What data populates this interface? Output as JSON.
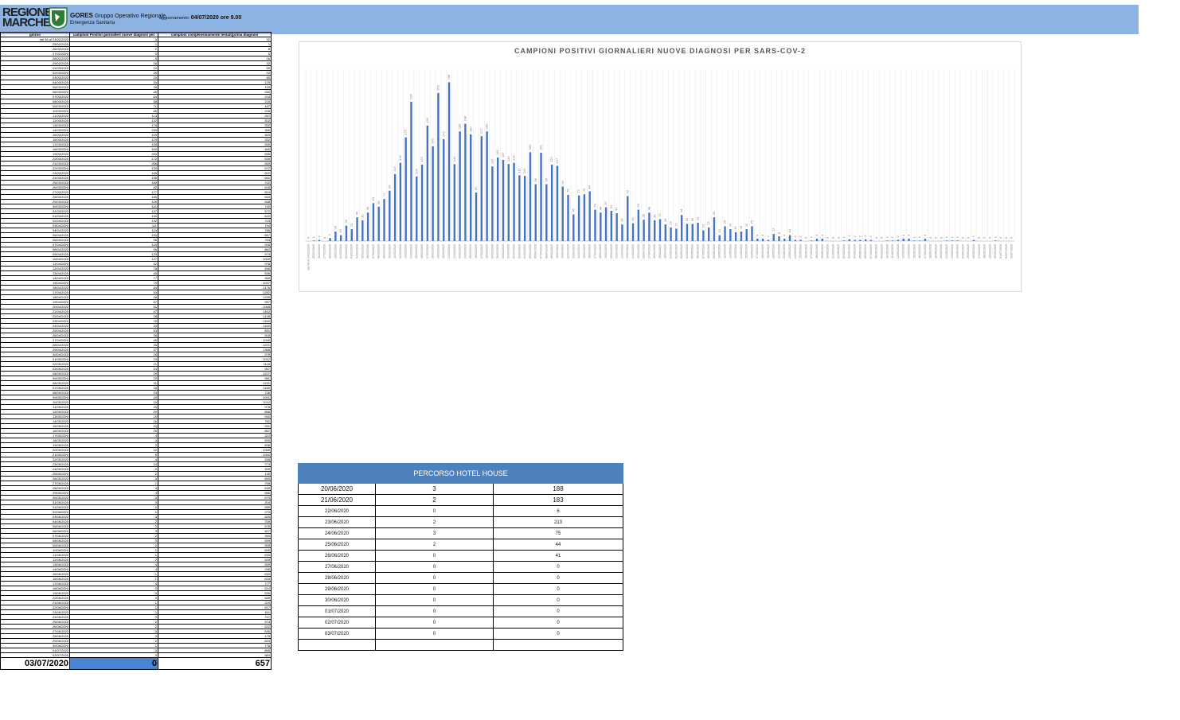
{
  "header": {
    "logo_lines": [
      "REGIONE",
      "MARCHE"
    ],
    "gores_label": "GORES",
    "gores_text": "Gruppo Operativo Regionale",
    "gores_sub": "Emergenza Sanitaria",
    "update_label": "aggiornamento:",
    "update_value": "04/07/2020 ore 9.00"
  },
  "colors": {
    "banner": "#8db3e2",
    "bar": "#4472c4",
    "table_header": "#4f81bd",
    "total_cell": "#4a84d2"
  },
  "daily_table": {
    "headers": [
      "giorno",
      "campioni Positivi giornalieri nuove diagnosi per",
      "campioni complessivamente testati(prima diagnosi"
    ],
    "rows": [
      [
        "dal 06 al 24/02/2020",
        "0",
        "32"
      ],
      [
        "25/02/2020",
        "1",
        "1"
      ],
      [
        "26/02/2020",
        "2",
        "8"
      ],
      [
        "27/02/2020",
        "0",
        "5"
      ],
      [
        "28/02/2020",
        "5",
        "16"
      ],
      [
        "29/02/2020",
        "16",
        "32"
      ],
      [
        "01/03/2020",
        "10",
        "50"
      ],
      [
        "02/03/2020",
        "26",
        "93"
      ],
      [
        "03/03/2020",
        "20",
        "85"
      ],
      [
        "04/03/2020",
        "40",
        "125"
      ],
      [
        "05/03/2020",
        "35",
        "150"
      ],
      [
        "06/03/2020",
        "48",
        "230"
      ],
      [
        "07/03/2020",
        "64",
        "218"
      ],
      [
        "08/03/2020",
        "58",
        "216"
      ],
      [
        "09/03/2020",
        "71",
        "187"
      ],
      [
        "10/03/2020",
        "85",
        "218"
      ],
      [
        "11/03/2020",
        "113",
        "257"
      ],
      [
        "12/03/2020",
        "132",
        "302"
      ],
      [
        "13/03/2020",
        "175",
        "332"
      ],
      [
        "14/03/2020",
        "235",
        "356"
      ],
      [
        "15/03/2020",
        "109",
        "300"
      ],
      [
        "16/03/2020",
        "129",
        "332"
      ],
      [
        "17/03/2020",
        "195",
        "530"
      ],
      [
        "18/03/2020",
        "160",
        "465"
      ],
      [
        "19/03/2020",
        "250",
        "556"
      ],
      [
        "20/03/2020",
        "172",
        "530"
      ],
      [
        "21/03/2020",
        "268",
        "650"
      ],
      [
        "22/03/2020",
        "130",
        "572"
      ],
      [
        "23/03/2020",
        "185",
        "602"
      ],
      [
        "24/03/2020",
        "198",
        "661"
      ],
      [
        "25/03/2020",
        "180",
        "742"
      ],
      [
        "26/03/2020",
        "82",
        "618"
      ],
      [
        "27/03/2020",
        "177",
        "824"
      ],
      [
        "28/03/2020",
        "185",
        "544"
      ],
      [
        "29/03/2020",
        "126",
        "548"
      ],
      [
        "30/03/2020",
        "141",
        "749"
      ],
      [
        "31/03/2020",
        "137",
        "572"
      ],
      [
        "01/04/2020",
        "130",
        "642"
      ],
      [
        "02/04/2020",
        "132",
        "743"
      ],
      [
        "03/04/2020",
        "111",
        "794"
      ],
      [
        "04/04/2020",
        "110",
        "786"
      ],
      [
        "05/04/2020",
        "150",
        "667"
      ],
      [
        "06/04/2020",
        "96",
        "763"
      ],
      [
        "07/04/2020",
        "149",
        "918"
      ],
      [
        "08/04/2020",
        "96",
        "862"
      ],
      [
        "09/04/2020",
        "129",
        "974"
      ],
      [
        "10/04/2020",
        "127",
        "1090"
      ],
      [
        "11/04/2020",
        "92",
        "976"
      ],
      [
        "12/04/2020",
        "78",
        "456"
      ],
      [
        "13/04/2020",
        "45",
        "636"
      ],
      [
        "14/04/2020",
        "77",
        "960"
      ],
      [
        "15/04/2020",
        "79",
        "1037"
      ],
      [
        "16/04/2020",
        "84",
        "1176"
      ],
      [
        "17/04/2020",
        "53",
        "1282"
      ],
      [
        "18/04/2020",
        "48",
        "1290"
      ],
      [
        "19/04/2020",
        "57",
        "957"
      ],
      [
        "20/04/2020",
        "51",
        "1068"
      ],
      [
        "21/04/2020",
        "47",
        "1452"
      ],
      [
        "22/04/2020",
        "28",
        "1136"
      ],
      [
        "23/04/2020",
        "76",
        "1160"
      ],
      [
        "24/04/2020",
        "30",
        "1160"
      ],
      [
        "25/04/2020",
        "53",
        "851"
      ],
      [
        "26/04/2020",
        "36",
        "518"
      ],
      [
        "27/04/2020",
        "48",
        "1046"
      ],
      [
        "28/04/2020",
        "35",
        "1221"
      ],
      [
        "29/04/2020",
        "37",
        "1368"
      ],
      [
        "30/04/2020",
        "28",
        "978"
      ],
      [
        "01/05/2020",
        "23",
        "1012"
      ],
      [
        "02/05/2020",
        "21",
        "1116"
      ],
      [
        "03/05/2020",
        "44",
        "557"
      ],
      [
        "04/05/2020",
        "29",
        "1207"
      ],
      [
        "05/05/2020",
        "29",
        "981"
      ],
      [
        "06/05/2020",
        "31",
        "1231"
      ],
      [
        "07/05/2020",
        "18",
        "1160"
      ],
      [
        "08/05/2020",
        "23",
        "736"
      ],
      [
        "09/05/2020",
        "40",
        "1091"
      ],
      [
        "10/05/2020",
        "10",
        "1012"
      ],
      [
        "11/05/2020",
        "25",
        "978"
      ],
      [
        "12/05/2020",
        "20",
        "866"
      ],
      [
        "13/05/2020",
        "15",
        "940"
      ],
      [
        "14/05/2020",
        "16",
        "782"
      ],
      [
        "15/05/2020",
        "20",
        "931"
      ],
      [
        "16/05/2020",
        "25",
        "867"
      ],
      [
        "17/05/2020",
        "4",
        "323"
      ],
      [
        "18/05/2020",
        "4",
        "590"
      ],
      [
        "19/05/2020",
        "2",
        "836"
      ],
      [
        "20/05/2020",
        "12",
        "1065"
      ],
      [
        "21/05/2020",
        "8",
        "1050"
      ],
      [
        "22/05/2020",
        "4",
        "538"
      ],
      [
        "23/05/2020",
        "10",
        "773"
      ],
      [
        "24/05/2020",
        "2",
        "399"
      ],
      [
        "25/05/2020",
        "2",
        "135"
      ],
      [
        "26/05/2020",
        "0",
        "890"
      ],
      [
        "27/05/2020",
        "1",
        "798"
      ],
      [
        "28/05/2020",
        "4",
        "630"
      ],
      [
        "29/05/2020",
        "4",
        "586"
      ],
      [
        "30/05/2020",
        "0",
        "670"
      ],
      [
        "31/05/2020",
        "0",
        "204"
      ],
      [
        "01/06/2020",
        "0",
        "589"
      ],
      [
        "02/06/2020",
        "1",
        "273"
      ],
      [
        "03/06/2020",
        "3",
        "625"
      ],
      [
        "04/06/2020",
        "2",
        "769"
      ],
      [
        "05/06/2020",
        "2",
        "578"
      ],
      [
        "06/06/2020",
        "3",
        "607"
      ],
      [
        "07/06/2020",
        "2",
        "390"
      ],
      [
        "08/06/2020",
        "0",
        "599"
      ],
      [
        "09/06/2020",
        "0",
        "555"
      ],
      [
        "10/06/2020",
        "1",
        "695"
      ],
      [
        "11/06/2020",
        "1",
        "630"
      ],
      [
        "12/06/2020",
        "2",
        "549"
      ],
      [
        "13/06/2020",
        "4",
        "590"
      ],
      [
        "14/06/2020",
        "4",
        "298"
      ],
      [
        "15/06/2020",
        "1",
        "630"
      ],
      [
        "16/06/2020",
        "1",
        "633"
      ],
      [
        "17/06/2020",
        "4",
        "777"
      ],
      [
        "18/06/2020",
        "0",
        "624"
      ],
      [
        "19/06/2020",
        "0",
        "536"
      ],
      [
        "20/06/2020",
        "0",
        "689"
      ],
      [
        "21/06/2020",
        "1",
        "224"
      ],
      [
        "22/06/2020",
        "1",
        "517"
      ],
      [
        "23/06/2020",
        "1",
        "611"
      ],
      [
        "24/06/2020",
        "0",
        "747"
      ],
      [
        "25/06/2020",
        "0",
        "574"
      ],
      [
        "26/06/2020",
        "2",
        "622"
      ],
      [
        "27/06/2020",
        "0",
        "636"
      ],
      [
        "28/06/2020",
        "0",
        "179"
      ],
      [
        "29/06/2020",
        "0",
        "624"
      ],
      [
        "30/06/2020",
        "1",
        "776"
      ],
      [
        "01/07/2020",
        "0",
        "866"
      ],
      [
        "02/07/2020",
        "0",
        "684"
      ]
    ],
    "total": [
      "03/07/2020",
      "0",
      "657"
    ]
  },
  "chart_data": {
    "type": "bar",
    "title": "CAMPIONI POSITIVI GIORNALIERI NUOVE DIAGNOSI PER SARS-COV-2",
    "categories": [
      "dal 06 al 24/02/2020",
      "25/02/2020",
      "26/02/2020",
      "27/02/2020",
      "28/02/2020",
      "29/02/2020",
      "01/03/2020",
      "02/03/2020",
      "03/03/2020",
      "04/03/2020",
      "05/03/2020",
      "06/03/2020",
      "07/03/2020",
      "08/03/2020",
      "09/03/2020",
      "10/03/2020",
      "11/03/2020",
      "12/03/2020",
      "13/03/2020",
      "14/03/2020",
      "15/03/2020",
      "16/03/2020",
      "17/03/2020",
      "18/03/2020",
      "19/03/2020",
      "20/03/2020",
      "21/03/2020",
      "22/03/2020",
      "23/03/2020",
      "24/03/2020",
      "25/03/2020",
      "26/03/2020",
      "27/03/2020",
      "28/03/2020",
      "29/03/2020",
      "30/03/2020",
      "31/03/2020",
      "01/04/2020",
      "02/04/2020",
      "03/04/2020",
      "04/04/2020",
      "05/04/2020",
      "06/04/2020",
      "07/04/2020",
      "08/04/2020",
      "09/04/2020",
      "10/04/2020",
      "11/04/2020",
      "12/04/2020",
      "13/04/2020",
      "14/04/2020",
      "15/04/2020",
      "16/04/2020",
      "17/04/2020",
      "18/04/2020",
      "19/04/2020",
      "20/04/2020",
      "21/04/2020",
      "22/04/2020",
      "23/04/2020",
      "24/04/2020",
      "25/04/2020",
      "26/04/2020",
      "27/04/2020",
      "28/04/2020",
      "29/04/2020",
      "30/04/2020",
      "01/05/2020",
      "02/05/2020",
      "03/05/2020",
      "04/05/2020",
      "05/05/2020",
      "06/05/2020",
      "07/05/2020",
      "08/05/2020",
      "09/05/2020",
      "10/05/2020",
      "11/05/2020",
      "12/05/2020",
      "13/05/2020",
      "14/05/2020",
      "15/05/2020",
      "16/05/2020",
      "17/05/2020",
      "18/05/2020",
      "19/05/2020",
      "20/05/2020",
      "21/05/2020",
      "22/05/2020",
      "23/05/2020",
      "24/05/2020",
      "25/05/2020",
      "26/05/2020",
      "27/05/2020",
      "28/05/2020",
      "29/05/2020",
      "30/05/2020",
      "31/05/2020",
      "01/06/2020",
      "02/06/2020",
      "03/06/2020",
      "04/06/2020",
      "05/06/2020",
      "06/06/2020",
      "07/06/2020",
      "08/06/2020",
      "09/06/2020",
      "10/06/2020",
      "11/06/2020",
      "12/06/2020",
      "13/06/2020",
      "14/06/2020",
      "15/06/2020",
      "16/06/2020",
      "17/06/2020",
      "18/06/2020",
      "19/06/2020",
      "20/06/2020",
      "21/06/2020",
      "22/06/2020",
      "23/06/2020",
      "24/06/2020",
      "25/06/2020",
      "26/06/2020",
      "27/06/2020",
      "28/06/2020",
      "29/06/2020",
      "30/06/2020",
      "01/07/2020",
      "02/07/2020",
      "03/07/2020"
    ],
    "values": [
      0,
      1,
      2,
      0,
      5,
      16,
      10,
      26,
      20,
      40,
      35,
      48,
      64,
      58,
      71,
      85,
      113,
      132,
      175,
      235,
      109,
      129,
      195,
      160,
      250,
      172,
      268,
      130,
      185,
      198,
      180,
      82,
      177,
      185,
      126,
      141,
      137,
      130,
      132,
      111,
      110,
      150,
      96,
      149,
      96,
      129,
      127,
      92,
      78,
      45,
      77,
      79,
      84,
      53,
      48,
      57,
      51,
      47,
      28,
      76,
      30,
      53,
      36,
      48,
      35,
      37,
      28,
      23,
      21,
      44,
      29,
      29,
      31,
      18,
      23,
      40,
      10,
      25,
      20,
      15,
      16,
      20,
      25,
      4,
      4,
      2,
      12,
      8,
      4,
      10,
      2,
      2,
      0,
      1,
      4,
      4,
      0,
      0,
      0,
      1,
      3,
      2,
      2,
      3,
      2,
      0,
      0,
      1,
      1,
      2,
      4,
      4,
      1,
      1,
      4,
      0,
      0,
      0,
      1,
      1,
      1,
      0,
      0,
      2,
      0,
      0,
      0,
      1,
      0,
      0,
      0
    ],
    "ylim": [
      0,
      290
    ],
    "grid": true,
    "legend": "none"
  },
  "hotel": {
    "title": "PERCORSO HOTEL HOUSE",
    "rows": [
      [
        "20/06/2020",
        "3",
        "188"
      ],
      [
        "21/06/2020",
        "2",
        "183"
      ],
      [
        "22/06/2020",
        "0",
        "6"
      ],
      [
        "23/06/2020",
        "2",
        "213"
      ],
      [
        "24/06/2020",
        "3",
        "75"
      ],
      [
        "25/06/2020",
        "2",
        "44"
      ],
      [
        "26/06/2020",
        "0",
        "41"
      ],
      [
        "27/06/2020",
        "0",
        "0"
      ],
      [
        "28/06/2020",
        "0",
        "0"
      ],
      [
        "29/06/2020",
        "0",
        "0"
      ],
      [
        "30/06/2020",
        "0",
        "0"
      ],
      [
        "01/07/2020",
        "0",
        "0"
      ],
      [
        "02/07/2020",
        "0",
        "0"
      ],
      [
        "03/07/2020",
        "0",
        "0"
      ],
      [
        "",
        "",
        ""
      ]
    ]
  }
}
